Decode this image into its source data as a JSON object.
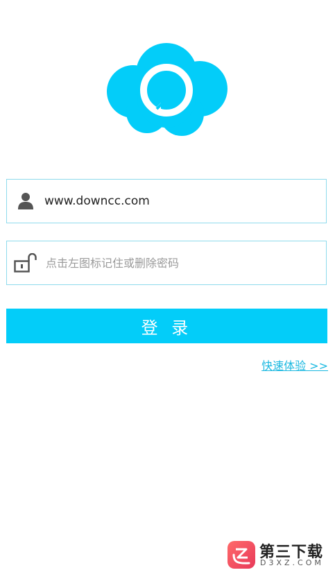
{
  "app": {
    "username_value": "www.downcc.com",
    "password_placeholder": "点击左图标记住或删除密码",
    "login_label": "登 录",
    "quick_link": "快速体验 >>"
  },
  "watermark": {
    "title": "第三下载",
    "subtitle": "D3XZ.COM"
  },
  "colors": {
    "accent": "#03cdf9",
    "field_border": "#8ddaec",
    "link": "#19b8e0"
  },
  "icons": {
    "username": "user-icon",
    "password": "unlock-icon",
    "logo": "cloud-chat-logo"
  }
}
